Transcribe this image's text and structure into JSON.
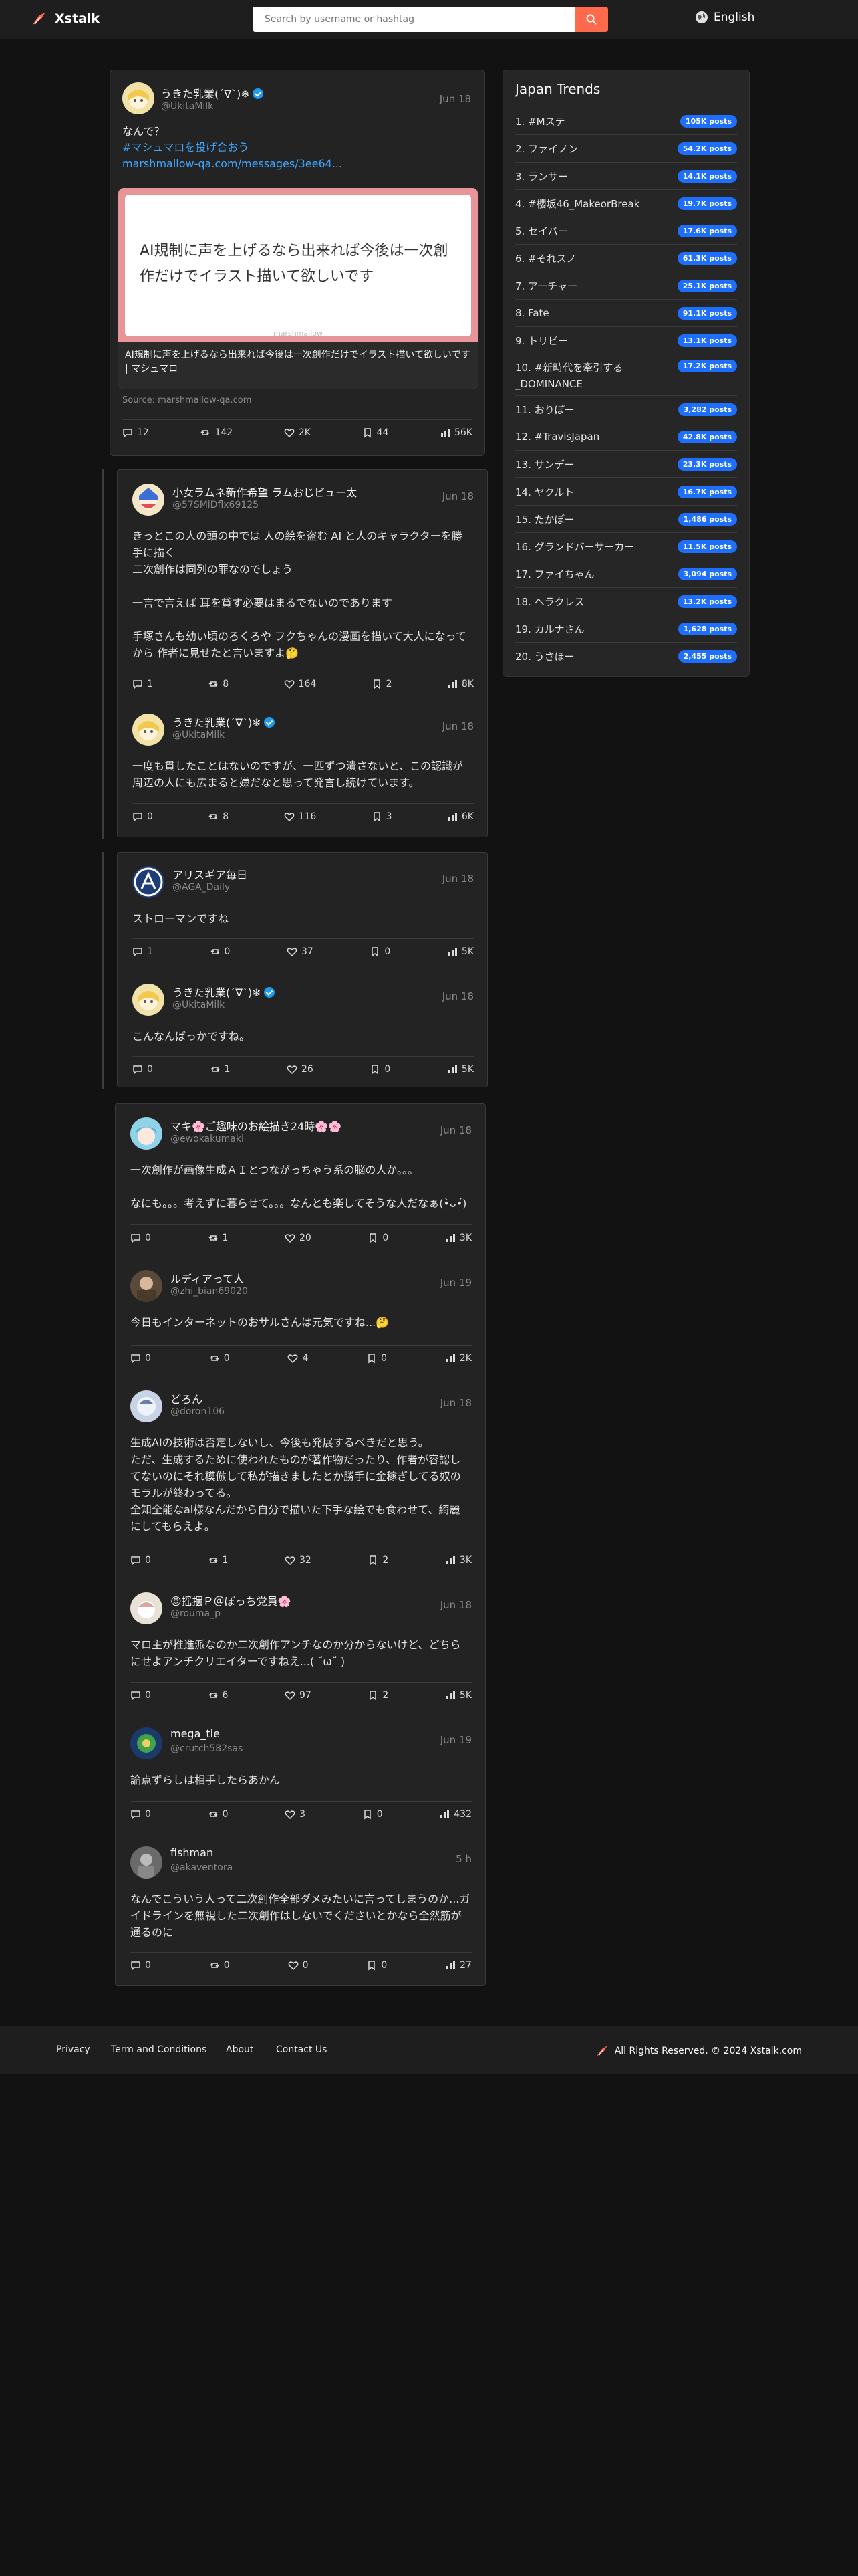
{
  "app": {
    "name": "Xstalk"
  },
  "search": {
    "placeholder": "Search by username or hashtag"
  },
  "language": {
    "label": "English"
  },
  "main_post": {
    "username": "うきた乳業(´∇`)❄",
    "handle": "@UkitaMilk",
    "date": "Jun 18",
    "text": "なんで？",
    "hashtag": "#マシュマロを投げ合おう",
    "url": "marshmallow-qa.com/messages/3ee64...",
    "card_text": "AI規制に声を上げるなら出来れば今後は一次創作だけでイラスト描いて欲しいです",
    "card_watermark": "marshmallow",
    "card_caption": "AI規制に声を上げるなら出来れば今後は一次創作だけでイラスト描いて欲しいです | マシュマロ",
    "source": "Source: marshmallow-qa.com",
    "stats": {
      "replies": "12",
      "retweets": "142",
      "likes": "2K",
      "bookmarks": "44",
      "views": "56K"
    }
  },
  "threads": [
    {
      "tweets": [
        {
          "username": "小女ラムネ新作希望 ラムおじビュー太",
          "handle": "@57SMiDflx69125",
          "date": "Jun 18",
          "text": "きっとこの人の頭の中では 人の絵を盗む AI と人のキャラクターを勝手に描く\n二次創作は同列の罪なのでしょう\n\n一言で言えば 耳を貸す必要はまるでないのであります\n\n手塚さんも幼い頃のろくろや フクちゃんの漫画を描いて大人になってから 作者に見せたと言いますよ🤔",
          "stats": {
            "replies": "1",
            "retweets": "8",
            "likes": "164",
            "bookmarks": "2",
            "views": "8K"
          }
        },
        {
          "username": "うきた乳業(´∇`)❄",
          "handle": "@UkitaMilk",
          "date": "Jun 18",
          "verified": true,
          "text": "一度も貫したことはないのですが、一匹ずつ潰さないと、この認識が周辺の人にも広まると嫌だなと思って発言し続けています。",
          "stats": {
            "replies": "0",
            "retweets": "8",
            "likes": "116",
            "bookmarks": "3",
            "views": "6K"
          }
        }
      ]
    },
    {
      "tweets": [
        {
          "username": "アリスギア毎日",
          "handle": "@AGA_Daily",
          "date": "Jun 18",
          "text": "ストローマンですね",
          "stats": {
            "replies": "1",
            "retweets": "0",
            "likes": "37",
            "bookmarks": "0",
            "views": "5K"
          }
        },
        {
          "username": "うきた乳業(´∇`)❄",
          "handle": "@UkitaMilk",
          "date": "Jun 18",
          "verified": true,
          "text": "こんなんばっかですね。",
          "stats": {
            "replies": "0",
            "retweets": "1",
            "likes": "26",
            "bookmarks": "0",
            "views": "5K"
          }
        }
      ]
    }
  ],
  "replies": [
    {
      "username": "マキ🌸ご趣味のお絵描き24時🌸🌸",
      "handle": "@ewokakumaki",
      "date": "Jun 18",
      "text": "一次創作が画像生成ＡＩとつながっちゃう系の脳の人か。。。\n\nなにも。。。考えずに暮らせて。。。なんとも楽してそうな人だなぁ(•̀ᴗ•́)",
      "stats": {
        "replies": "0",
        "retweets": "1",
        "likes": "20",
        "bookmarks": "0",
        "views": "3K"
      }
    },
    {
      "username": "ルディアって人",
      "handle": "@zhi_bian69020",
      "date": "Jun 19",
      "text": "今日もインターネットのおサルさんは元気ですね...🤔",
      "stats": {
        "replies": "0",
        "retweets": "0",
        "likes": "4",
        "bookmarks": "0",
        "views": "2K"
      }
    },
    {
      "username": "どろん",
      "handle": "@doron106",
      "date": "Jun 18",
      "text": "生成AIの技術は否定しないし、今後も発展するべきだと思う。\nただ、生成するために使われたものが著作物だったり、作者が容認してないのにそれ模倣して私が描きましたとか勝手に金稼ぎしてる奴のモラルが終わってる。\n全知全能なai様なんだから自分で描いた下手な絵でも食わせて、綺麗にしてもらえよ。",
      "stats": {
        "replies": "0",
        "retweets": "1",
        "likes": "32",
        "bookmarks": "2",
        "views": "3K"
      }
    },
    {
      "username": "😡摇摆Ｐ＠ぼっち党員🌸",
      "handle": "@rouma_p",
      "date": "Jun 18",
      "text": "マロ主が推進派なのか二次創作アンチなのか分からないけど、どちらにせよアンチクリエイターですねえ...( ˘ω˘ )",
      "stats": {
        "replies": "0",
        "retweets": "6",
        "likes": "97",
        "bookmarks": "2",
        "views": "5K"
      }
    },
    {
      "username": "mega_tie",
      "handle": "@crutch582sas",
      "date": "Jun 19",
      "text": "論点ずらしは相手したらあかん",
      "stats": {
        "replies": "0",
        "retweets": "0",
        "likes": "3",
        "bookmarks": "0",
        "views": "432"
      }
    },
    {
      "username": "fishman",
      "handle": "@akaventora",
      "date": "5 h",
      "text": "なんでこういう人って二次創作全部ダメみたいに言ってしまうのか...ガイドラインを無視した二次創作はしないでくださいとかなら全然筋が通るのに",
      "stats": {
        "replies": "0",
        "retweets": "0",
        "likes": "0",
        "bookmarks": "0",
        "views": "27"
      }
    }
  ],
  "trends": {
    "title": "Japan Trends",
    "items": [
      {
        "label": "1. #Mステ",
        "count": "105K posts"
      },
      {
        "label": "2. ファイノン",
        "count": "54.2K posts"
      },
      {
        "label": "3. ランサー",
        "count": "14.1K posts"
      },
      {
        "label": "4. #櫻坂46_MakeorBreak",
        "count": "19.7K posts"
      },
      {
        "label": "5. セイバー",
        "count": "17.6K posts"
      },
      {
        "label": "6. #それスノ",
        "count": "61.3K posts"
      },
      {
        "label": "7. アーチャー",
        "count": "25.1K posts"
      },
      {
        "label": "8. Fate",
        "count": "91.1K posts"
      },
      {
        "label": "9. トリビー",
        "count": "13.1K posts"
      },
      {
        "label": "10. #新時代を牽引する_DOMINANCE",
        "count": "17.2K posts"
      },
      {
        "label": "11. おりぽー",
        "count": "3,282 posts"
      },
      {
        "label": "12. #TravisJapan",
        "count": "42.8K posts"
      },
      {
        "label": "13. サンデー",
        "count": "23.3K posts"
      },
      {
        "label": "14. ヤクルト",
        "count": "16.7K posts"
      },
      {
        "label": "15. たかぽー",
        "count": "1,486 posts"
      },
      {
        "label": "16. グランドバーサーカー",
        "count": "11.5K posts"
      },
      {
        "label": "17. ファイちゃん",
        "count": "3,094 posts"
      },
      {
        "label": "18. ヘラクレス",
        "count": "13.2K posts"
      },
      {
        "label": "19. カルナさん",
        "count": "1,628 posts"
      },
      {
        "label": "20. うさほー",
        "count": "2,455 posts"
      }
    ]
  },
  "footer": {
    "links": [
      "Privacy",
      "Term and Conditions",
      "About",
      "Contact Us"
    ],
    "copyright": "All Rights Reserved. © 2024 Xstalk.com"
  },
  "colors": {
    "accent": "#ff6a4d",
    "badge": "#1f6fff",
    "link": "#3ea6ff",
    "verified": "#1d9bf0"
  }
}
